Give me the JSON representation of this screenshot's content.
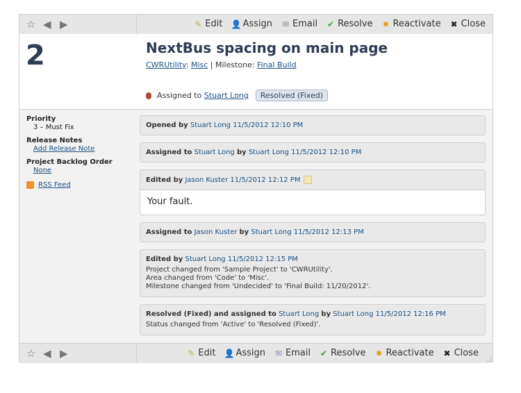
{
  "case": {
    "number": "2",
    "title": "NextBus spacing on main page",
    "project": "CWRUtility",
    "area": "Misc",
    "milestone_label": "Milestone:",
    "milestone": "Final Build",
    "assigned_prefix": "Assigned to",
    "assigned_to": "Stuart Long",
    "status": "Resolved (Fixed)"
  },
  "toolbar": {
    "actions": [
      {
        "label": "Edit",
        "icon": "edit-icon"
      },
      {
        "label": "Assign",
        "icon": "assign-user-icon"
      },
      {
        "label": "Email",
        "icon": "email-icon"
      },
      {
        "label": "Resolve",
        "icon": "checkmark-icon"
      },
      {
        "label": "Reactivate",
        "icon": "reactivate-icon"
      },
      {
        "label": "Close",
        "icon": "close-x-icon"
      }
    ]
  },
  "sidebar": {
    "priority_label": "Priority",
    "priority_value": "3 – Must Fix",
    "release_notes_label": "Release Notes",
    "release_notes_link": "Add Release Note",
    "backlog_label": "Project Backlog Order",
    "backlog_value": "None",
    "rss_label": "RSS Feed"
  },
  "events": [
    {
      "action": "Opened by",
      "user": "Stuart Long",
      "time": "11/5/2012 12:10 PM"
    },
    {
      "action": "Assigned to",
      "user": "Stuart Long",
      "by": "by",
      "by_user": "Stuart Long",
      "time": "11/5/2012 12:10 PM"
    },
    {
      "action": "Edited by",
      "user": "Jason Kuster",
      "time": "11/5/2012 12:12 PM",
      "body": "Your fault."
    },
    {
      "action": "Assigned to",
      "user": "Jason Kuster",
      "by": "by",
      "by_user": "Stuart Long",
      "time": "11/5/2012 12:13 PM"
    },
    {
      "action": "Edited by",
      "user": "Stuart Long",
      "time": "11/5/2012 12:15 PM",
      "details": [
        "Project changed from 'Sample Project' to 'CWRUtility'.",
        "Area changed from 'Code' to 'Misc'.",
        "Milestone changed from 'Undecided' to 'Final Build: 11/20/2012'."
      ]
    },
    {
      "action": "Resolved (Fixed) and assigned to",
      "user": "Stuart Long",
      "by": "by",
      "by_user": "Stuart Long",
      "time": "11/5/2012 12:16 PM",
      "details": [
        "Status changed from 'Active' to 'Resolved (Fixed)'."
      ]
    }
  ],
  "colors": {
    "accent": "#2d3c52",
    "link": "#1a4f80",
    "badge_bg": "#dde4ee"
  }
}
